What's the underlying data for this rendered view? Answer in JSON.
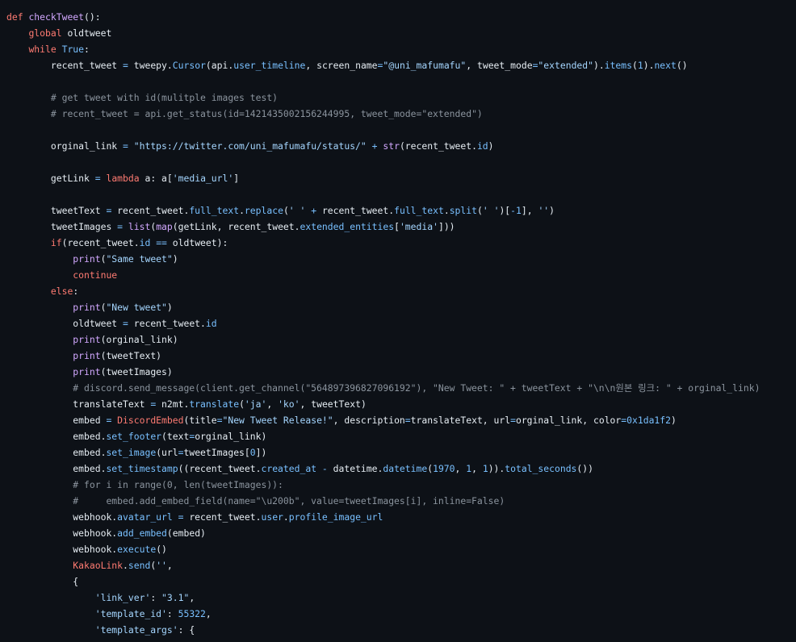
{
  "theme": {
    "background": "#0d1117",
    "colors": {
      "plain": "#e6edf3",
      "keyword": "#ff7b72",
      "function": "#d2a8ff",
      "constant": "#79c0ff",
      "string": "#a5d6ff",
      "comment": "#8b949e"
    }
  },
  "code": {
    "language": "python",
    "lines": [
      {
        "indent": 0,
        "tokens": [
          [
            "keyword",
            "def"
          ],
          [
            "plain",
            " "
          ],
          [
            "function",
            "checkTweet"
          ],
          [
            "plain",
            "():"
          ]
        ]
      },
      {
        "indent": 1,
        "tokens": [
          [
            "keyword",
            "global"
          ],
          [
            "plain",
            " oldtweet"
          ]
        ]
      },
      {
        "indent": 1,
        "tokens": [
          [
            "keyword",
            "while"
          ],
          [
            "plain",
            " "
          ],
          [
            "constant",
            "True"
          ],
          [
            "plain",
            ":"
          ]
        ]
      },
      {
        "indent": 2,
        "tokens": [
          [
            "plain",
            "recent_tweet "
          ],
          [
            "constant",
            "="
          ],
          [
            "plain",
            " tweepy."
          ],
          [
            "constant",
            "Cursor"
          ],
          [
            "plain",
            "(api."
          ],
          [
            "constant",
            "user_timeline"
          ],
          [
            "plain",
            ", screen_name"
          ],
          [
            "constant",
            "="
          ],
          [
            "string",
            "\"@uni_mafumafu\""
          ],
          [
            "plain",
            ", tweet_mode"
          ],
          [
            "constant",
            "="
          ],
          [
            "string",
            "\"extended\""
          ],
          [
            "plain",
            ")."
          ],
          [
            "constant",
            "items"
          ],
          [
            "plain",
            "("
          ],
          [
            "constant",
            "1"
          ],
          [
            "plain",
            ")."
          ],
          [
            "constant",
            "next"
          ],
          [
            "plain",
            "()"
          ]
        ]
      },
      {
        "indent": 0,
        "tokens": []
      },
      {
        "indent": 2,
        "tokens": [
          [
            "comment",
            "# get tweet with id(mulitple images test)"
          ]
        ]
      },
      {
        "indent": 2,
        "tokens": [
          [
            "comment",
            "# recent_tweet = api.get_status(id=1421435002156244995, tweet_mode=\"extended\")"
          ]
        ]
      },
      {
        "indent": 0,
        "tokens": []
      },
      {
        "indent": 2,
        "tokens": [
          [
            "plain",
            "orginal_link "
          ],
          [
            "constant",
            "="
          ],
          [
            "plain",
            " "
          ],
          [
            "string",
            "\"https://twitter.com/uni_mafumafu/status/\""
          ],
          [
            "plain",
            " "
          ],
          [
            "constant",
            "+"
          ],
          [
            "plain",
            " "
          ],
          [
            "function",
            "str"
          ],
          [
            "plain",
            "(recent_tweet."
          ],
          [
            "constant",
            "id"
          ],
          [
            "plain",
            ")"
          ]
        ]
      },
      {
        "indent": 0,
        "tokens": []
      },
      {
        "indent": 2,
        "tokens": [
          [
            "plain",
            "getLink "
          ],
          [
            "constant",
            "="
          ],
          [
            "plain",
            " "
          ],
          [
            "keyword",
            "lambda"
          ],
          [
            "plain",
            " a: a["
          ],
          [
            "string",
            "'media_url'"
          ],
          [
            "plain",
            "]"
          ]
        ]
      },
      {
        "indent": 0,
        "tokens": []
      },
      {
        "indent": 2,
        "tokens": [
          [
            "plain",
            "tweetText "
          ],
          [
            "constant",
            "="
          ],
          [
            "plain",
            " recent_tweet."
          ],
          [
            "constant",
            "full_text"
          ],
          [
            "plain",
            "."
          ],
          [
            "constant",
            "replace"
          ],
          [
            "plain",
            "("
          ],
          [
            "string",
            "' '"
          ],
          [
            "plain",
            " "
          ],
          [
            "constant",
            "+"
          ],
          [
            "plain",
            " recent_tweet."
          ],
          [
            "constant",
            "full_text"
          ],
          [
            "plain",
            "."
          ],
          [
            "constant",
            "split"
          ],
          [
            "plain",
            "("
          ],
          [
            "string",
            "' '"
          ],
          [
            "plain",
            ")["
          ],
          [
            "constant",
            "-1"
          ],
          [
            "plain",
            "], "
          ],
          [
            "string",
            "''"
          ],
          [
            "plain",
            ")"
          ]
        ]
      },
      {
        "indent": 2,
        "tokens": [
          [
            "plain",
            "tweetImages "
          ],
          [
            "constant",
            "="
          ],
          [
            "plain",
            " "
          ],
          [
            "function",
            "list"
          ],
          [
            "plain",
            "("
          ],
          [
            "function",
            "map"
          ],
          [
            "plain",
            "(getLink, recent_tweet."
          ],
          [
            "constant",
            "extended_entities"
          ],
          [
            "plain",
            "["
          ],
          [
            "string",
            "'media'"
          ],
          [
            "plain",
            "]))"
          ]
        ]
      },
      {
        "indent": 2,
        "tokens": [
          [
            "keyword",
            "if"
          ],
          [
            "plain",
            "(recent_tweet."
          ],
          [
            "constant",
            "id"
          ],
          [
            "plain",
            " "
          ],
          [
            "constant",
            "=="
          ],
          [
            "plain",
            " oldtweet):"
          ]
        ]
      },
      {
        "indent": 3,
        "tokens": [
          [
            "function",
            "print"
          ],
          [
            "plain",
            "("
          ],
          [
            "string",
            "\"Same tweet\""
          ],
          [
            "plain",
            ")"
          ]
        ]
      },
      {
        "indent": 3,
        "tokens": [
          [
            "keyword",
            "continue"
          ]
        ]
      },
      {
        "indent": 2,
        "tokens": [
          [
            "keyword",
            "else"
          ],
          [
            "plain",
            ":"
          ]
        ]
      },
      {
        "indent": 3,
        "tokens": [
          [
            "function",
            "print"
          ],
          [
            "plain",
            "("
          ],
          [
            "string",
            "\"New tweet\""
          ],
          [
            "plain",
            ")"
          ]
        ]
      },
      {
        "indent": 3,
        "tokens": [
          [
            "plain",
            "oldtweet "
          ],
          [
            "constant",
            "="
          ],
          [
            "plain",
            " recent_tweet."
          ],
          [
            "constant",
            "id"
          ]
        ]
      },
      {
        "indent": 3,
        "tokens": [
          [
            "function",
            "print"
          ],
          [
            "plain",
            "(orginal_link)"
          ]
        ]
      },
      {
        "indent": 3,
        "tokens": [
          [
            "function",
            "print"
          ],
          [
            "plain",
            "(tweetText)"
          ]
        ]
      },
      {
        "indent": 3,
        "tokens": [
          [
            "function",
            "print"
          ],
          [
            "plain",
            "(tweetImages)"
          ]
        ]
      },
      {
        "indent": 3,
        "tokens": [
          [
            "comment",
            "# discord.send_message(client.get_channel(\"564897396827096192\"), \"New Tweet: \" + tweetText + \"\\n\\n원본 링크: \" + orginal_link)"
          ]
        ]
      },
      {
        "indent": 3,
        "tokens": [
          [
            "plain",
            "translateText "
          ],
          [
            "constant",
            "="
          ],
          [
            "plain",
            " n2mt."
          ],
          [
            "constant",
            "translate"
          ],
          [
            "plain",
            "("
          ],
          [
            "string",
            "'ja'"
          ],
          [
            "plain",
            ", "
          ],
          [
            "string",
            "'ko'"
          ],
          [
            "plain",
            ", tweetText)"
          ]
        ]
      },
      {
        "indent": 3,
        "tokens": [
          [
            "plain",
            "embed "
          ],
          [
            "constant",
            "="
          ],
          [
            "plain",
            " "
          ],
          [
            "keyword",
            "DiscordEmbed"
          ],
          [
            "plain",
            "(title"
          ],
          [
            "constant",
            "="
          ],
          [
            "string",
            "\"New Tweet Release!\""
          ],
          [
            "plain",
            ", description"
          ],
          [
            "constant",
            "="
          ],
          [
            "plain",
            "translateText, url"
          ],
          [
            "constant",
            "="
          ],
          [
            "plain",
            "orginal_link, color"
          ],
          [
            "constant",
            "="
          ],
          [
            "constant",
            "0x1da1f2"
          ],
          [
            "plain",
            ")"
          ]
        ]
      },
      {
        "indent": 3,
        "tokens": [
          [
            "plain",
            "embed."
          ],
          [
            "constant",
            "set_footer"
          ],
          [
            "plain",
            "(text"
          ],
          [
            "constant",
            "="
          ],
          [
            "plain",
            "orginal_link)"
          ]
        ]
      },
      {
        "indent": 3,
        "tokens": [
          [
            "plain",
            "embed."
          ],
          [
            "constant",
            "set_image"
          ],
          [
            "plain",
            "(url"
          ],
          [
            "constant",
            "="
          ],
          [
            "plain",
            "tweetImages["
          ],
          [
            "constant",
            "0"
          ],
          [
            "plain",
            "])"
          ]
        ]
      },
      {
        "indent": 3,
        "tokens": [
          [
            "plain",
            "embed."
          ],
          [
            "constant",
            "set_timestamp"
          ],
          [
            "plain",
            "((recent_tweet."
          ],
          [
            "constant",
            "created_at"
          ],
          [
            "plain",
            " "
          ],
          [
            "constant",
            "-"
          ],
          [
            "plain",
            " datetime."
          ],
          [
            "constant",
            "datetime"
          ],
          [
            "plain",
            "("
          ],
          [
            "constant",
            "1970"
          ],
          [
            "plain",
            ", "
          ],
          [
            "constant",
            "1"
          ],
          [
            "plain",
            ", "
          ],
          [
            "constant",
            "1"
          ],
          [
            "plain",
            "))."
          ],
          [
            "constant",
            "total_seconds"
          ],
          [
            "plain",
            "())"
          ]
        ]
      },
      {
        "indent": 3,
        "tokens": [
          [
            "comment",
            "# for i in range(0, len(tweetImages)):"
          ]
        ]
      },
      {
        "indent": 3,
        "tokens": [
          [
            "comment",
            "#     embed.add_embed_field(name=\"\\u200b\", value=tweetImages[i], inline=False)"
          ]
        ]
      },
      {
        "indent": 3,
        "tokens": [
          [
            "plain",
            "webhook."
          ],
          [
            "constant",
            "avatar_url"
          ],
          [
            "plain",
            " "
          ],
          [
            "constant",
            "="
          ],
          [
            "plain",
            " recent_tweet."
          ],
          [
            "constant",
            "user"
          ],
          [
            "plain",
            "."
          ],
          [
            "constant",
            "profile_image_url"
          ]
        ]
      },
      {
        "indent": 3,
        "tokens": [
          [
            "plain",
            "webhook."
          ],
          [
            "constant",
            "add_embed"
          ],
          [
            "plain",
            "(embed)"
          ]
        ]
      },
      {
        "indent": 3,
        "tokens": [
          [
            "plain",
            "webhook."
          ],
          [
            "constant",
            "execute"
          ],
          [
            "plain",
            "()"
          ]
        ]
      },
      {
        "indent": 3,
        "tokens": [
          [
            "keyword",
            "KakaoLink"
          ],
          [
            "plain",
            "."
          ],
          [
            "constant",
            "send"
          ],
          [
            "plain",
            "("
          ],
          [
            "string",
            "''"
          ],
          [
            "plain",
            ","
          ]
        ]
      },
      {
        "indent": 3,
        "tokens": [
          [
            "plain",
            "{"
          ]
        ]
      },
      {
        "indent": 4,
        "tokens": [
          [
            "string",
            "'link_ver'"
          ],
          [
            "plain",
            ": "
          ],
          [
            "string",
            "\"3.1\""
          ],
          [
            "plain",
            ","
          ]
        ]
      },
      {
        "indent": 4,
        "tokens": [
          [
            "string",
            "'template_id'"
          ],
          [
            "plain",
            ": "
          ],
          [
            "constant",
            "55322"
          ],
          [
            "plain",
            ","
          ]
        ]
      },
      {
        "indent": 4,
        "tokens": [
          [
            "string",
            "'template_args'"
          ],
          [
            "plain",
            ": {"
          ]
        ]
      }
    ]
  }
}
